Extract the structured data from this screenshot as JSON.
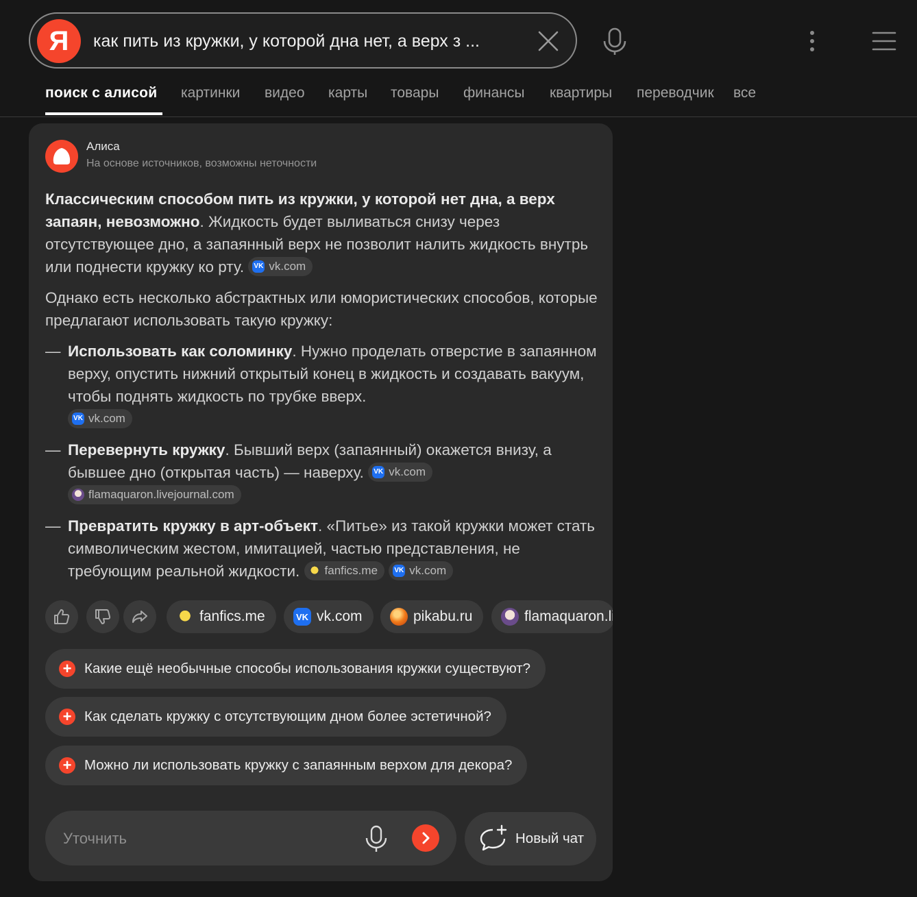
{
  "search": {
    "logo": "Я",
    "query": "как пить из кружки, у которой дна нет, а верх з ..."
  },
  "tabs": [
    {
      "label": "поиск с алисой",
      "active": true
    },
    {
      "label": "картинки"
    },
    {
      "label": "видео"
    },
    {
      "label": "карты"
    },
    {
      "label": "товары"
    },
    {
      "label": "финансы"
    },
    {
      "label": "квартиры"
    },
    {
      "label": "переводчик"
    },
    {
      "label": "все"
    }
  ],
  "alice": {
    "name": "Алиса",
    "subtitle": "На основе источников, возможны неточности"
  },
  "answer": {
    "p1_bold": "Классическим способом пить из кружки, у которой нет дна, а верх запаян, невозможно",
    "p1_rest": ". Жидкость будет выливаться снизу через отсутствующее дно, а запаянный верх не позволит налить жидкость внутрь или поднести кружку ко рту.",
    "p2": "Однако есть несколько абстрактных или юмористических способов, которые предлагают использовать такую кружку:",
    "dash": "—",
    "items": [
      {
        "bold": "Использовать как соломинку",
        "text": ". Нужно проделать отверстие в запаянном верху, опустить нижний открытый конец в жидкость и создавать вакуум, чтобы поднять жидкость по трубке вверх."
      },
      {
        "bold": "Перевернуть кружку",
        "text": ". Бывший верх (запаянный) окажется внизу, а бывшее дно (открытая часть) — наверху."
      },
      {
        "bold": "Превратить кружку в арт-объект",
        "text": ". «Питье» из такой кружки может стать символическим жестом, имитацией, частью представления, не требующим реальной жидкости."
      }
    ]
  },
  "source_names": {
    "vk": "vk.com",
    "flamaquaron": "flamaquaron.livejournal.com",
    "fanfics": "fanfics.me",
    "pikabu": "pikabu.ru",
    "flamaquaron_truncated": "flamaquaron.li"
  },
  "vk_glyph": "VK",
  "suggestions": [
    "Какие ещё необычные способы использования кружки существуют?",
    "Как сделать кружку с отсутствующим дном более эстетичной?",
    "Можно ли использовать кружку с запаянным верхом для декора?"
  ],
  "plus_glyph": "+",
  "refine": {
    "placeholder": "Уточнить"
  },
  "new_chat": "Новый чат",
  "colors": {
    "accent": "#f5452c",
    "background": "#171717",
    "card": "#2a2a2a",
    "vk": "#1e6ff0"
  }
}
